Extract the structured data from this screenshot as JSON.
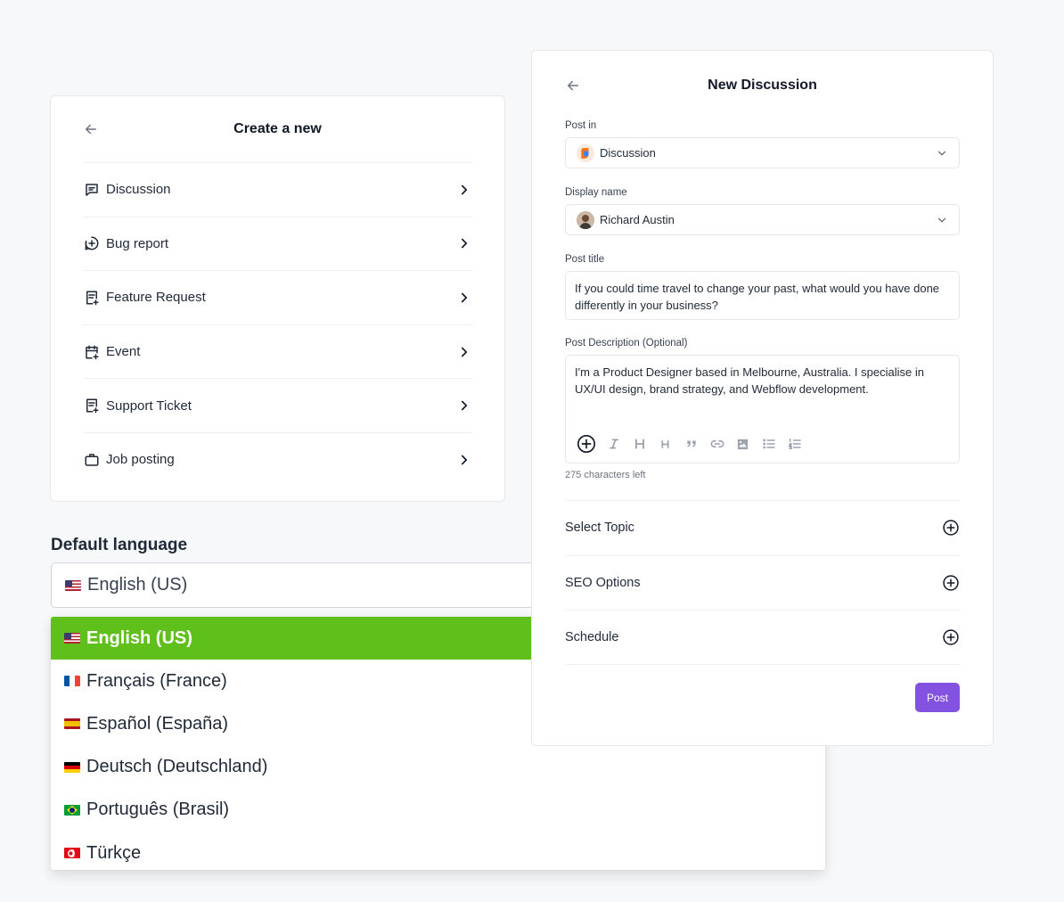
{
  "create": {
    "title": "Create a new",
    "items": [
      {
        "label": "Discussion",
        "icon": "chat-bubble-icon"
      },
      {
        "label": "Bug report",
        "icon": "bug-plus-icon"
      },
      {
        "label": "Feature Request",
        "icon": "document-plus-icon"
      },
      {
        "label": "Event",
        "icon": "calendar-plus-icon"
      },
      {
        "label": "Support Ticket",
        "icon": "ticket-document-icon"
      },
      {
        "label": "Job posting",
        "icon": "briefcase-icon"
      }
    ]
  },
  "language": {
    "title": "Default language",
    "selected": "English (US)",
    "options": [
      {
        "label": "English (US)",
        "flag": "us",
        "selected": true
      },
      {
        "label": "Français (France)",
        "flag": "fr"
      },
      {
        "label": "Español (España)",
        "flag": "es"
      },
      {
        "label": "Deutsch (Deutschland)",
        "flag": "de"
      },
      {
        "label": "Português (Brasil)",
        "flag": "br"
      },
      {
        "label": "Türkçe",
        "flag": "tr"
      }
    ],
    "accent_color": "#5fbf1b"
  },
  "discussion": {
    "title": "New Discussion",
    "post_in": {
      "label": "Post in",
      "value": "Discussion"
    },
    "display_name": {
      "label": "Display name",
      "value": "Richard Austin"
    },
    "post_title": {
      "label": "Post title",
      "value": "If you could time travel to change your past, what would you have done differently in your business?"
    },
    "description": {
      "label": "Post Description (Optional)",
      "value": "I'm a Product Designer based in Melbourne, Australia. I specialise in UX/UI design, brand strategy, and Webflow development."
    },
    "chars_left": "275 characters left",
    "toolbar": [
      "add-icon",
      "italic-icon",
      "heading-1-icon",
      "heading-2-icon",
      "quote-icon",
      "link-icon",
      "image-icon",
      "bullet-list-icon",
      "numbered-list-icon"
    ],
    "accordion": [
      {
        "label": "Select Topic"
      },
      {
        "label": "SEO Options"
      },
      {
        "label": "Schedule"
      }
    ],
    "post_button": "Post",
    "accent_color": "#8352e0"
  }
}
